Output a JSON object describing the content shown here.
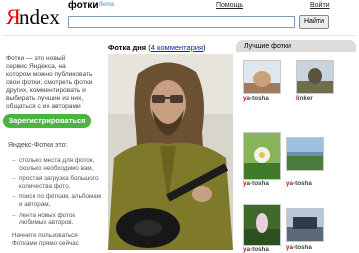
{
  "logo": {
    "first_letter": "Я",
    "rest": "ndex"
  },
  "header": {
    "service": "фотки",
    "beta": "бета",
    "help": "Помощь",
    "login": "Войти"
  },
  "search": {
    "value": "",
    "button": "Найти"
  },
  "intro": {
    "lines": [
      "Фотки — это новый",
      "сервис Яндекса, на",
      "котором можно публиковать",
      "свои фотки, смотреть фотки",
      "других, комментировать и",
      "выбирать лучшие из них,",
      "общаться с их авторами"
    ]
  },
  "register_button": "Зарегистрироваться",
  "features": {
    "title": "Яндекс-Фотки это:",
    "items": [
      {
        "lines": [
          "столько места для фоток,",
          "сколько необходимо вам,"
        ]
      },
      {
        "lines": [
          "простая загрузка большого",
          "количества фото,"
        ]
      },
      {
        "lines": [
          "поиск по фоткам, альбомам",
          "и авторам,"
        ]
      },
      {
        "lines": [
          "лента новых фоток",
          "любимых авторов."
        ]
      }
    ],
    "footer": [
      "Начните пользоваться",
      "Фотками прямо сейчас"
    ]
  },
  "photo_of_day": {
    "title": "Фотка дня",
    "open_paren": "(",
    "comments_link": "4 комментария",
    "close_paren": ")"
  },
  "best_photos": {
    "tab": "Лучшие фотки",
    "thumbs": [
      {
        "user": "ya-tosha",
        "sky": "#dfe6ee",
        "ground": "#a07a5a",
        "subject": "#c9a27a"
      },
      {
        "user": "linker",
        "sky": "#c9d3db",
        "ground": "#6e6e4a",
        "subject": "#5d5240"
      },
      {
        "user": "ya-tosha",
        "sky": "#8ab45a",
        "ground": "#3f7a2a",
        "subject": "#f2f2e8"
      },
      {
        "user": "ya-tosha",
        "sky": "#9fc0e0",
        "ground": "#4b7a3a",
        "subject": "#6e8fa8"
      },
      {
        "user": "ya-tosha",
        "sky": "#3f6a2a",
        "ground": "#2d4f20",
        "subject": "#e8d0e0"
      },
      {
        "user": "ya-tosha",
        "sky": "#b8c6d6",
        "ground": "#5a6a7a",
        "subject": "#303a48"
      }
    ]
  }
}
